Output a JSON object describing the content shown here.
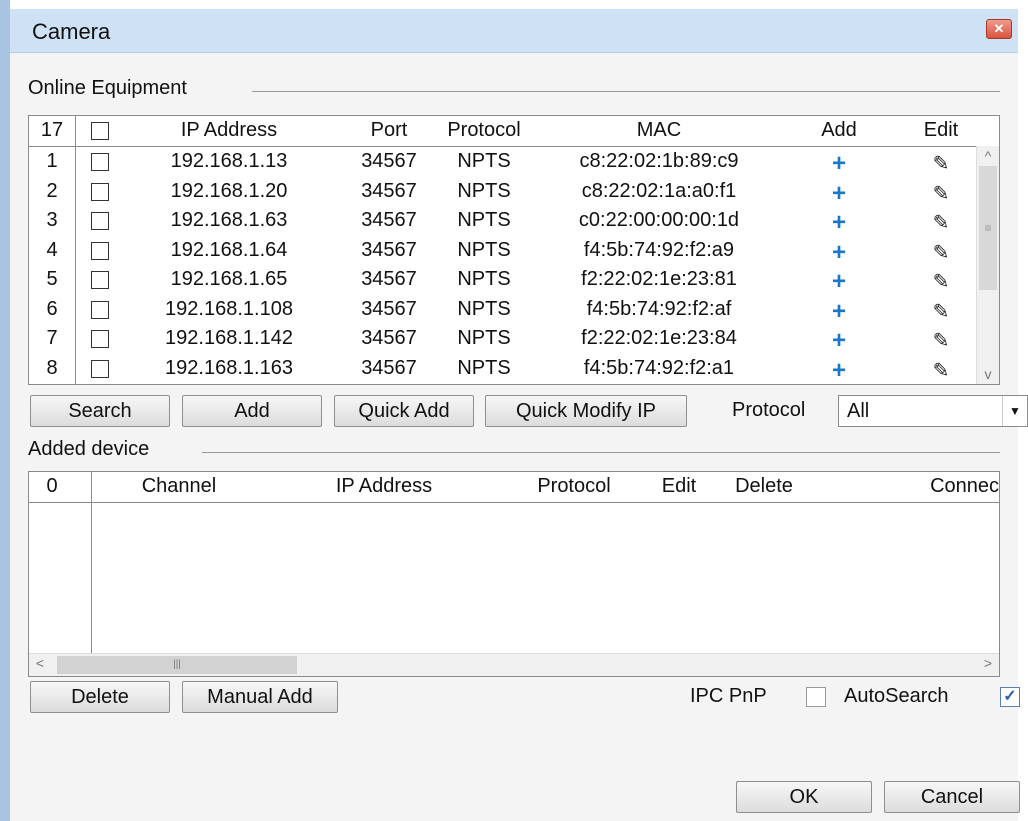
{
  "window": {
    "title": "Camera",
    "close_icon": "close-icon"
  },
  "online": {
    "section_label": "Online Equipment",
    "headers": {
      "count": "17",
      "ip": "IP Address",
      "port": "Port",
      "protocol": "Protocol",
      "mac": "MAC",
      "add": "Add",
      "edit": "Edit"
    },
    "rows": [
      {
        "num": "1",
        "ip": "192.168.1.13",
        "port": "34567",
        "protocol": "NPTS",
        "mac": "c8:22:02:1b:89:c9"
      },
      {
        "num": "2",
        "ip": "192.168.1.20",
        "port": "34567",
        "protocol": "NPTS",
        "mac": "c8:22:02:1a:a0:f1"
      },
      {
        "num": "3",
        "ip": "192.168.1.63",
        "port": "34567",
        "protocol": "NPTS",
        "mac": "c0:22:00:00:00:1d"
      },
      {
        "num": "4",
        "ip": "192.168.1.64",
        "port": "34567",
        "protocol": "NPTS",
        "mac": "f4:5b:74:92:f2:a9"
      },
      {
        "num": "5",
        "ip": "192.168.1.65",
        "port": "34567",
        "protocol": "NPTS",
        "mac": "f2:22:02:1e:23:81"
      },
      {
        "num": "6",
        "ip": "192.168.1.108",
        "port": "34567",
        "protocol": "NPTS",
        "mac": "f4:5b:74:92:f2:af"
      },
      {
        "num": "7",
        "ip": "192.168.1.142",
        "port": "34567",
        "protocol": "NPTS",
        "mac": "f2:22:02:1e:23:84"
      },
      {
        "num": "8",
        "ip": "192.168.1.163",
        "port": "34567",
        "protocol": "NPTS",
        "mac": "f4:5b:74:92:f2:a1"
      }
    ],
    "add_icon": "+",
    "edit_icon": "✎"
  },
  "toolbar": {
    "search_label": "Search",
    "add_label": "Add",
    "quick_add_label": "Quick Add",
    "quick_modify_label": "Quick Modify IP",
    "protocol_label": "Protocol",
    "protocol_value": "All"
  },
  "added": {
    "section_label": "Added device",
    "headers": {
      "count": "0",
      "channel": "Channel",
      "ip": "IP Address",
      "protocol": "Protocol",
      "edit": "Edit",
      "delete": "Delete",
      "connect": "Connec"
    }
  },
  "bottom": {
    "delete_label": "Delete",
    "manual_add_label": "Manual Add",
    "ipc_pnp_label": "IPC PnP",
    "ipc_pnp_checked": false,
    "autosearch_label": "AutoSearch",
    "autosearch_checked": true
  },
  "footer": {
    "ok_label": "OK",
    "cancel_label": "Cancel"
  },
  "colors": {
    "titlebar": "#cfe1f5",
    "accent_plus": "#1976c8",
    "close": "#d9533f"
  }
}
